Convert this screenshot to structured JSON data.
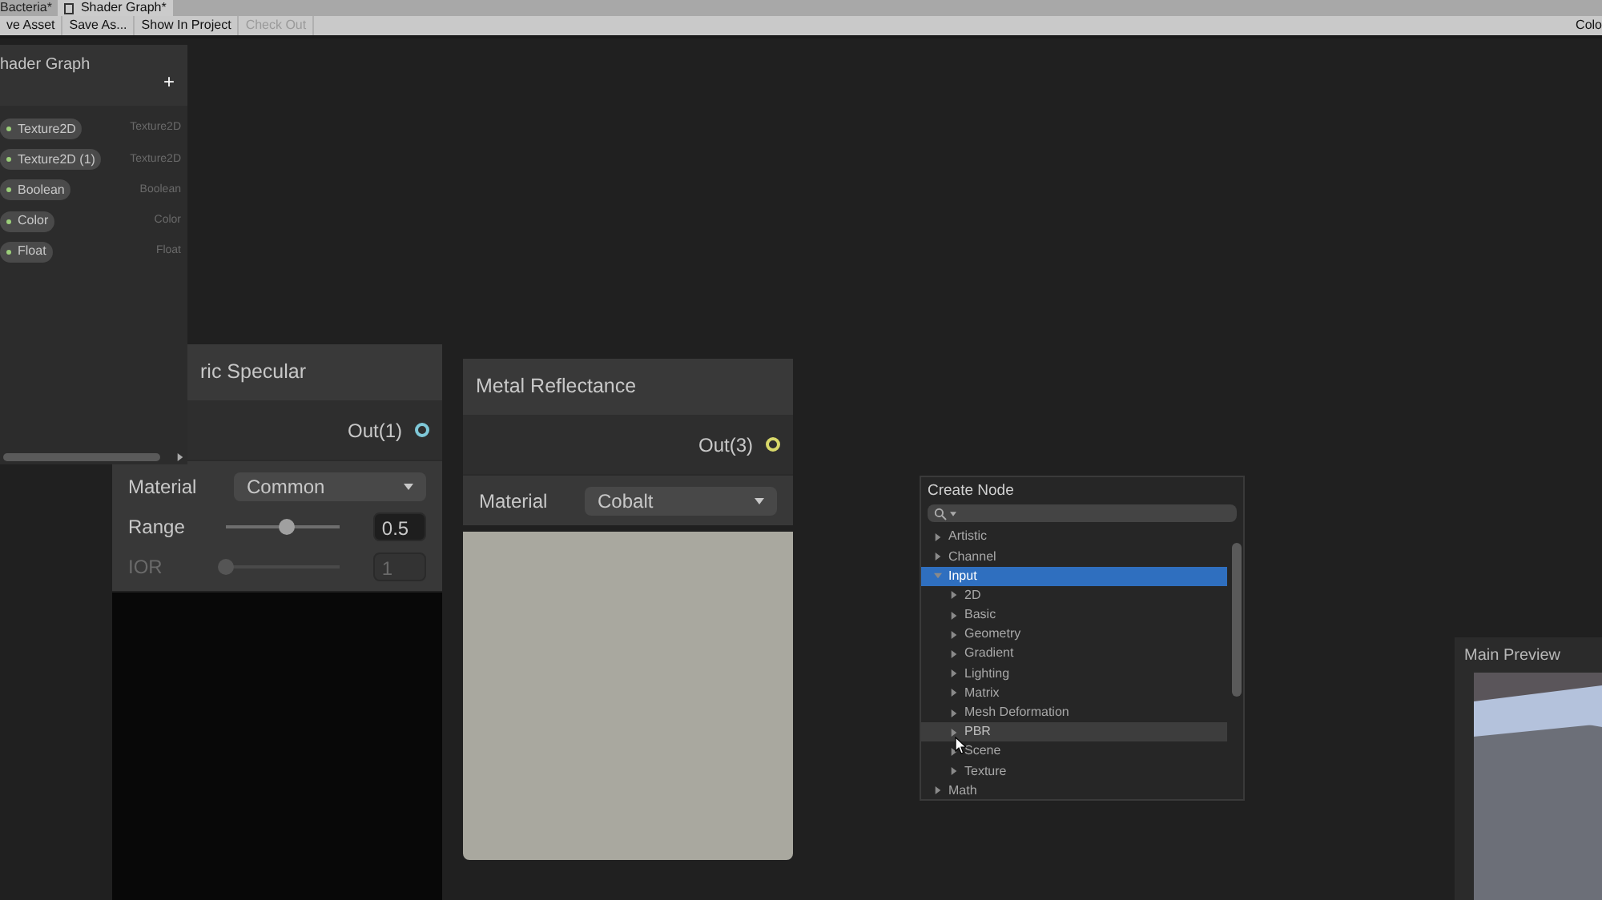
{
  "tabs": [
    {
      "label": "Bacteria*",
      "selected": false
    },
    {
      "label": "Shader Graph*",
      "selected": true
    }
  ],
  "toolbar": {
    "buttons": [
      {
        "label": "ve Asset",
        "disabled": false
      },
      {
        "label": "Save As...",
        "disabled": false
      },
      {
        "label": "Show In Project",
        "disabled": false
      },
      {
        "label": "Check Out",
        "disabled": true
      }
    ],
    "right_label": "Colo"
  },
  "blackboard": {
    "title": "hader Graph",
    "add": "+",
    "properties": [
      {
        "name": "Texture2D",
        "type": "Texture2D"
      },
      {
        "name": "Texture2D (1)",
        "type": "Texture2D"
      },
      {
        "name": "Boolean",
        "type": "Boolean"
      },
      {
        "name": "Color",
        "type": "Color"
      },
      {
        "name": "Float",
        "type": "Float"
      }
    ]
  },
  "nodes": [
    {
      "title": "ric Specular",
      "output": "Out(1)",
      "color": "#7fc8d8",
      "params": [
        {
          "kind": "dropdown",
          "label": "Material",
          "value": "Common",
          "disabled": false
        },
        {
          "kind": "slider",
          "label": "Range",
          "level": 0.5,
          "value": "0.5",
          "disabled": false
        },
        {
          "kind": "slider",
          "label": "IOR",
          "level": 0,
          "value": "1",
          "disabled": true
        }
      ],
      "kind": "dark"
    },
    {
      "title": "Metal Reflectance",
      "output": "Out(3)",
      "color": "#d8d86a",
      "params": [
        {
          "kind": "dropdown",
          "label": "Material",
          "value": "Cobalt",
          "disabled": false
        }
      ],
      "kind": "light"
    }
  ],
  "create_node": {
    "title": "Create Node",
    "items": [
      {
        "label": "Artistic",
        "expanded": false,
        "selected": false,
        "hovered": false
      },
      {
        "label": "Channel",
        "expanded": false,
        "selected": false,
        "hovered": false
      },
      {
        "label": "Input",
        "expanded": true,
        "selected": true,
        "hovered": false,
        "children": [
          {
            "label": "2D",
            "expanded": false,
            "selected": false,
            "hovered": false
          },
          {
            "label": "Basic",
            "expanded": false,
            "selected": false,
            "hovered": false
          },
          {
            "label": "Geometry",
            "expanded": false,
            "selected": false,
            "hovered": false
          },
          {
            "label": "Gradient",
            "expanded": false,
            "selected": false,
            "hovered": false
          },
          {
            "label": "Lighting",
            "expanded": false,
            "selected": false,
            "hovered": false
          },
          {
            "label": "Matrix",
            "expanded": false,
            "selected": false,
            "hovered": false
          },
          {
            "label": "Mesh Deformation",
            "expanded": false,
            "selected": false,
            "hovered": false
          },
          {
            "label": "PBR",
            "expanded": false,
            "selected": false,
            "hovered": true
          },
          {
            "label": "Scene",
            "expanded": false,
            "selected": false,
            "hovered": false
          },
          {
            "label": "Texture",
            "expanded": false,
            "selected": false,
            "hovered": false
          }
        ]
      },
      {
        "label": "Math",
        "expanded": false,
        "selected": false,
        "hovered": false
      }
    ]
  },
  "main_preview": {
    "title": "Main Preview"
  }
}
